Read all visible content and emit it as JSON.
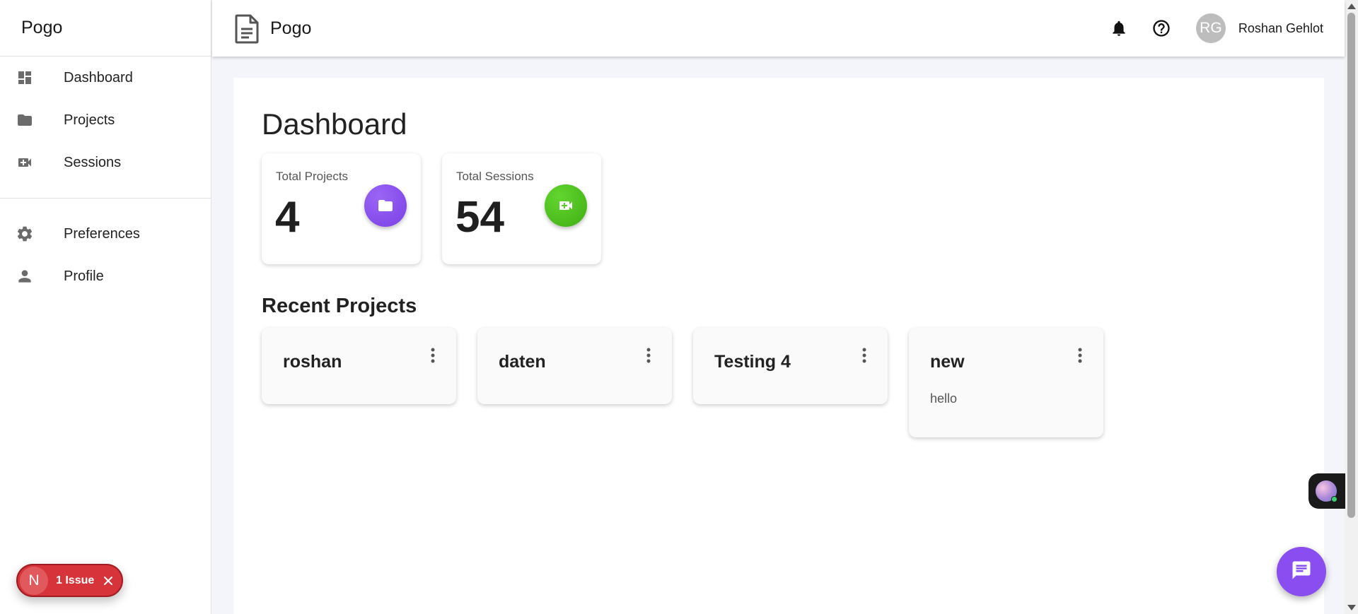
{
  "sidebar": {
    "brand": "Pogo",
    "items": [
      {
        "label": "Dashboard",
        "icon": "dashboard-icon"
      },
      {
        "label": "Projects",
        "icon": "folder-icon"
      },
      {
        "label": "Sessions",
        "icon": "video-icon"
      },
      {
        "label": "Preferences",
        "icon": "gear-icon"
      },
      {
        "label": "Profile",
        "icon": "person-icon"
      }
    ]
  },
  "header": {
    "title": "Pogo",
    "avatar_initials": "RG",
    "user_name": "Roshan Gehlot"
  },
  "main": {
    "title": "Dashboard",
    "stats": [
      {
        "label": "Total Projects",
        "value": "4",
        "icon": "folder-icon",
        "color": "#8a4df0"
      },
      {
        "label": "Total Sessions",
        "value": "54",
        "icon": "video-icon",
        "color": "#49c21a"
      }
    ],
    "recent_title": "Recent Projects",
    "projects": [
      {
        "name": "roshan",
        "description": ""
      },
      {
        "name": "daten",
        "description": ""
      },
      {
        "name": "Testing 4",
        "description": ""
      },
      {
        "name": "new",
        "description": "hello"
      }
    ]
  },
  "issue_badge": {
    "initial": "N",
    "label": "1 Issue",
    "color": "#d7333a"
  },
  "chat_fab": {
    "icon": "chat-icon",
    "color": "#8a4df0"
  }
}
